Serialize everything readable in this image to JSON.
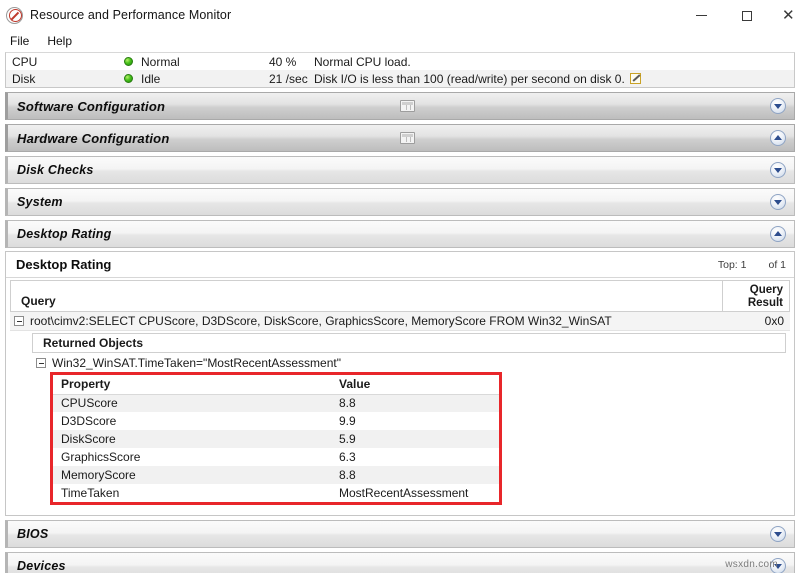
{
  "window": {
    "title": "Resource and Performance Monitor",
    "icon": "no-entry-icon",
    "controls": {
      "minimize": "–",
      "maximize": "□",
      "close": "✕"
    }
  },
  "menu": {
    "items": [
      {
        "label": "File"
      },
      {
        "label": "Help"
      }
    ]
  },
  "status_rows": [
    {
      "component": "CPU",
      "state": "Normal",
      "value": "40 %",
      "description": "Normal CPU load.",
      "has_note_icon": false,
      "led_color": "#49c21b"
    },
    {
      "component": "Disk",
      "state": "Idle",
      "value": "21 /sec",
      "description": "Disk I/O is less than 100 (read/write) per second on disk 0.",
      "has_note_icon": true,
      "led_color": "#49c21b"
    }
  ],
  "sections": [
    {
      "title": "Software Configuration",
      "expanded": false,
      "style": "dark",
      "grid_icon": true
    },
    {
      "title": "Hardware Configuration",
      "expanded": true,
      "style": "dark",
      "grid_icon": true
    },
    {
      "title": "Disk Checks",
      "expanded": false,
      "style": "light",
      "grid_icon": false
    },
    {
      "title": "System",
      "expanded": false,
      "style": "light",
      "grid_icon": false
    },
    {
      "title": "Desktop Rating",
      "expanded": true,
      "style": "light",
      "grid_icon": false
    }
  ],
  "bottom_sections": [
    {
      "title": "BIOS",
      "expanded": false,
      "style": "light"
    },
    {
      "title": "Devices",
      "expanded": false,
      "style": "light"
    }
  ],
  "desktop_rating": {
    "panel_title": "Desktop Rating",
    "top_label": "Top: 1",
    "of_label": "of 1",
    "columns": {
      "query": "Query",
      "result_line1": "Query",
      "result_line2": "Result"
    },
    "query_row": {
      "text": "root\\cimv2:SELECT CPUScore, D3DScore, DiskScore, GraphicsScore, MemoryScore FROM Win32_WinSAT",
      "result": "0x0"
    },
    "returned_objects_label": "Returned Objects",
    "object_label": "Win32_WinSAT.TimeTaken=\"MostRecentAssessment\"",
    "property_table": {
      "headers": {
        "property": "Property",
        "value": "Value"
      },
      "rows": [
        {
          "property": "CPUScore",
          "value": "8.8"
        },
        {
          "property": "D3DScore",
          "value": "9.9"
        },
        {
          "property": "DiskScore",
          "value": "5.9"
        },
        {
          "property": "GraphicsScore",
          "value": "6.3"
        },
        {
          "property": "MemoryScore",
          "value": "8.8"
        },
        {
          "property": "TimeTaken",
          "value": "MostRecentAssessment"
        }
      ]
    },
    "highlight_color": "#e8262a"
  },
  "watermark": "wsxdn.com"
}
